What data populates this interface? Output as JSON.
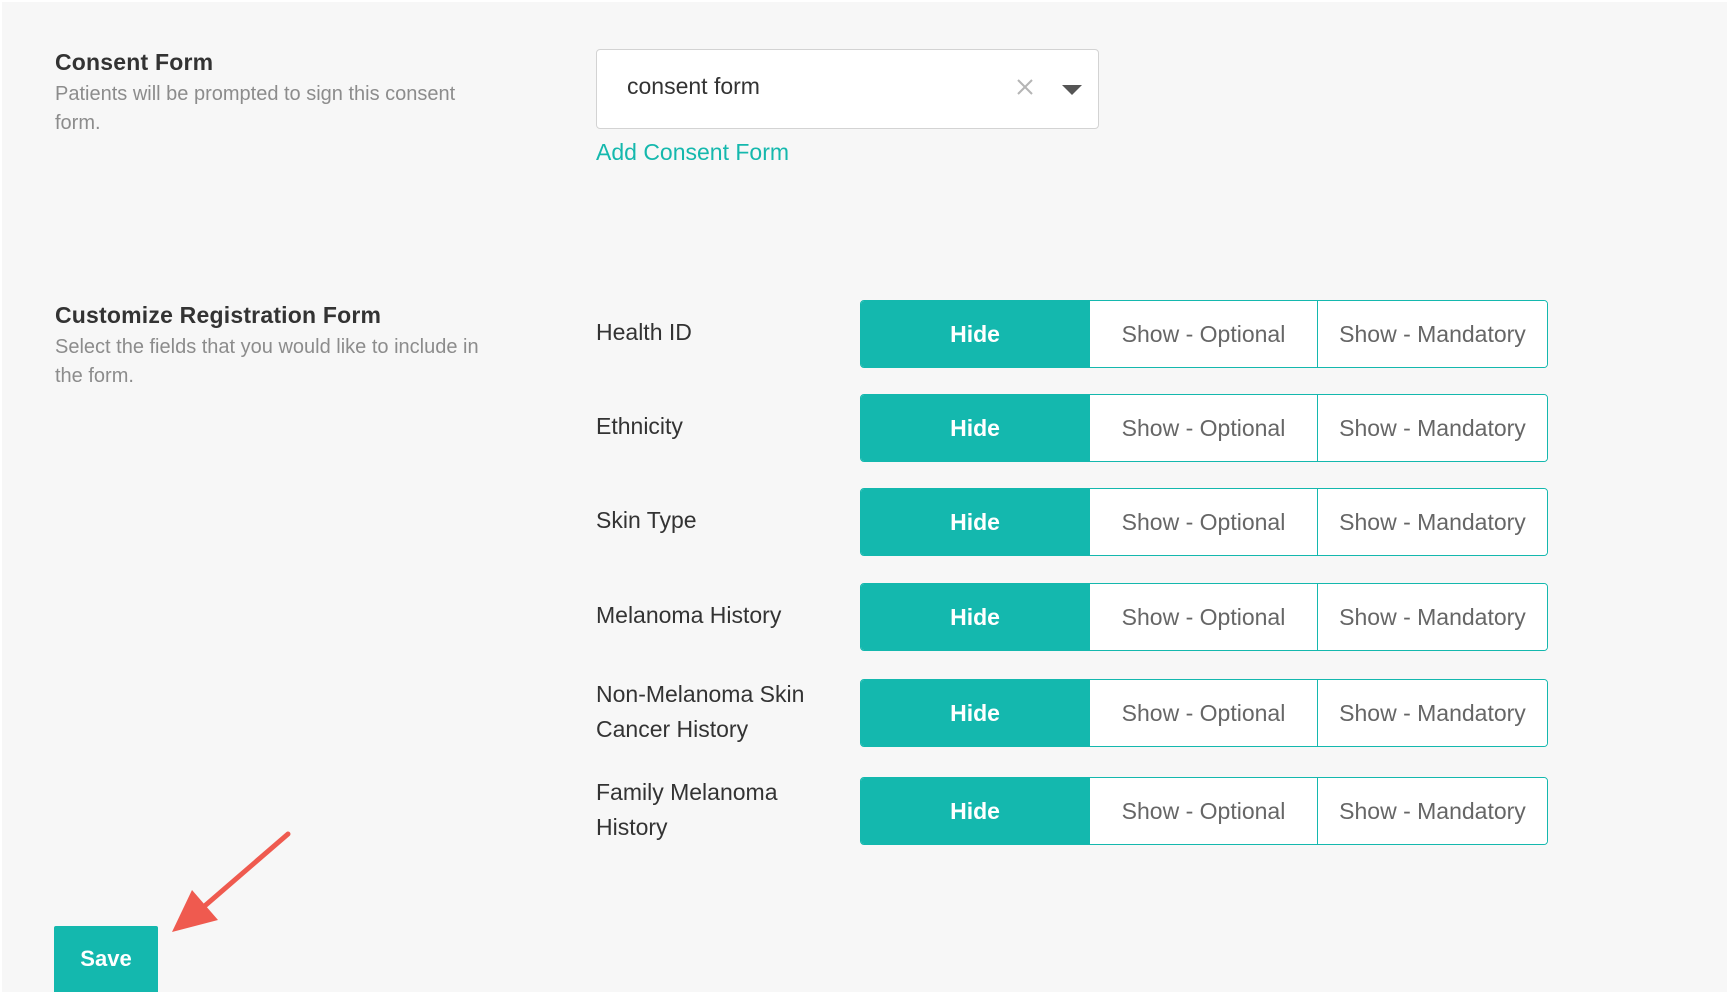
{
  "consent": {
    "title": "Consent Form",
    "description": "Patients will be prompted to sign this consent form.",
    "selected_value": "consent form",
    "add_link": "Add Consent Form"
  },
  "registration": {
    "title": "Customize Registration Form",
    "description": "Select the fields that you would like to include in the form.",
    "option_labels": [
      "Hide",
      "Show - Optional",
      "Show - Mandatory"
    ],
    "fields": [
      {
        "label": "Health ID",
        "selected": "Hide"
      },
      {
        "label": "Ethnicity",
        "selected": "Hide"
      },
      {
        "label": "Skin Type",
        "selected": "Hide"
      },
      {
        "label": "Melanoma History",
        "selected": "Hide"
      },
      {
        "label": "Non-Melanoma Skin Cancer History",
        "selected": "Hide"
      },
      {
        "label": "Family Melanoma History",
        "selected": "Hide"
      }
    ]
  },
  "actions": {
    "save_label": "Save"
  },
  "icons": {
    "clear": "close-icon",
    "dropdown": "caret-down-icon",
    "annotation": "arrow-annotation"
  },
  "colors": {
    "accent": "#14b8ae",
    "link": "#15b8ad",
    "annotation_arrow": "#ef5a4f"
  }
}
